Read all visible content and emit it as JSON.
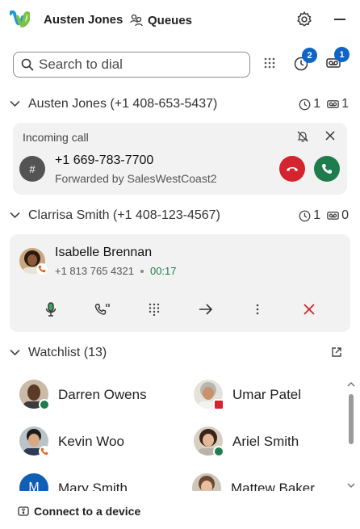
{
  "header": {
    "user_name": "Austen Jones",
    "queues_label": "Queues"
  },
  "search": {
    "placeholder": "Search to dial"
  },
  "badges": {
    "recent_calls": "2",
    "voicemail": "1"
  },
  "line1": {
    "title": "Austen Jones (+1 408-653-5437)",
    "recent_count": "1",
    "voicemail_count": "1"
  },
  "incoming_call": {
    "state": "Incoming call",
    "avatar_glyph": "#",
    "number": "+1 669-783-7700",
    "forwarded_by": "Forwarded by SalesWestCoast2"
  },
  "line2": {
    "title": "Clarrisa Smith (+1 408-123-4567)",
    "recent_count": "1",
    "voicemail_count": "0"
  },
  "active_call": {
    "name": "Isabelle Brennan",
    "number": "+1 813 765 4321",
    "duration": "00:17"
  },
  "watchlist": {
    "title": "Watchlist (13)",
    "people": [
      {
        "name": "Darren Owens",
        "status": "available"
      },
      {
        "name": "Umar Patel",
        "status": "presenting"
      },
      {
        "name": "Kevin Woo",
        "status": "on-call"
      },
      {
        "name": "Ariel Smith",
        "status": "available"
      },
      {
        "name": "Mary Smith",
        "initial": "M"
      },
      {
        "name": "Mattew Baker"
      }
    ]
  },
  "footer": {
    "connect_label": "Connect to a device"
  },
  "colors": {
    "accent": "#0e65c6",
    "decline": "#d4252e",
    "answer": "#1e7d4c",
    "available": "#1e7d4c",
    "presenting": "#d4252e",
    "on_call": "#e0661b"
  },
  "icons": {
    "logo": "webex-logo",
    "queues": "queues-icon",
    "settings": "gear-icon",
    "search": "search-icon",
    "dialpad": "dialpad-icon",
    "recents": "clock-icon",
    "voicemail": "voicemail-icon",
    "popout": "popout-icon",
    "device": "device-icon"
  }
}
